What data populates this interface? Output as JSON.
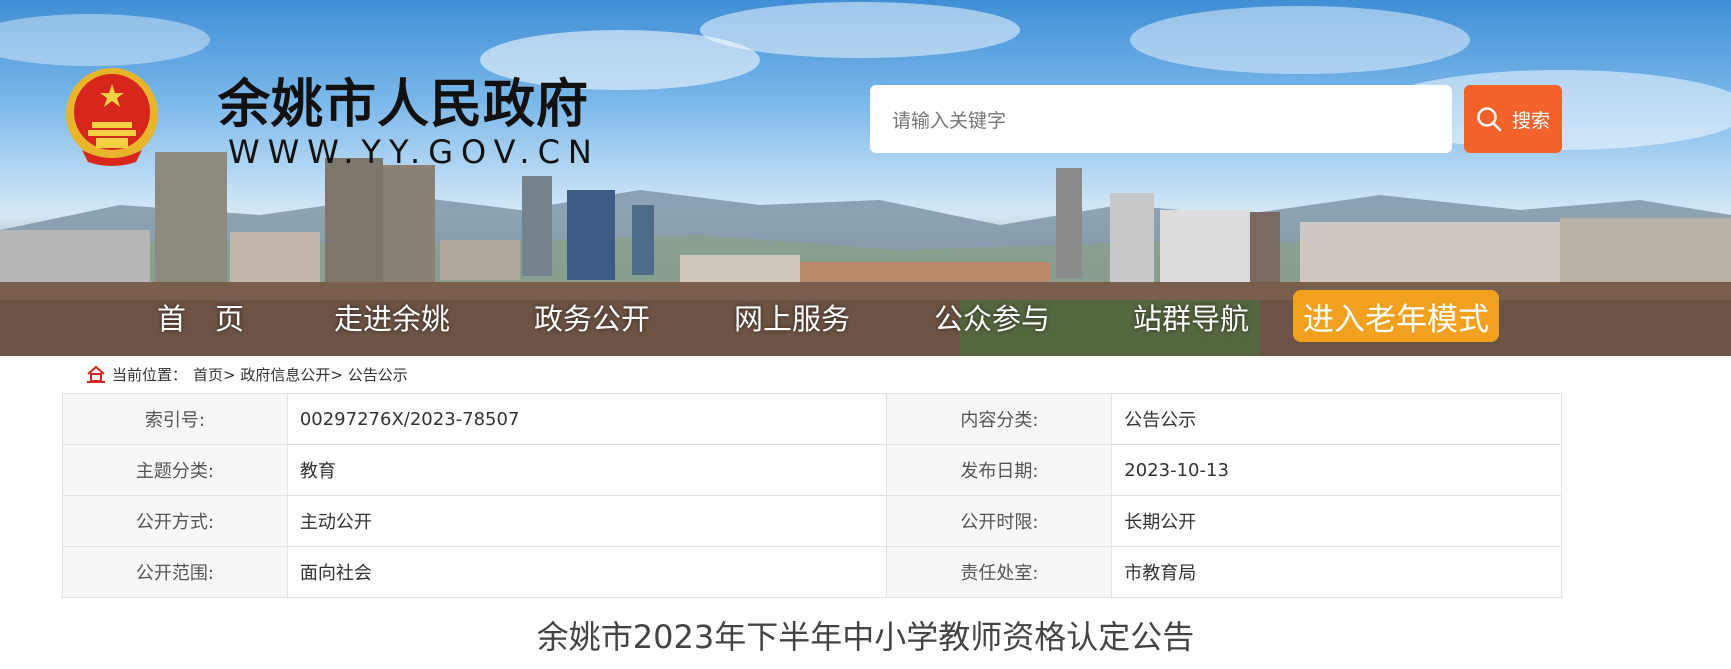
{
  "header": {
    "site_title": "余姚市人民政府",
    "site_url": "WWW.YY.GOV.CN",
    "emblem_icon": "national-emblem-icon"
  },
  "search": {
    "placeholder": "请输入关键字",
    "button_label": "搜索",
    "button_icon": "search-icon",
    "button_color": "#f2622a"
  },
  "nav": {
    "items": [
      "首　页",
      "走进余姚",
      "政务公开",
      "网上服务",
      "公众参与",
      "站群导航"
    ],
    "elder_mode_label": "进入老年模式",
    "elder_mode_color": "#f1a11d"
  },
  "breadcrumb": {
    "icon": "home-icon",
    "prefix": "当前位置：",
    "path": "首页> 政府信息公开> 公告公示"
  },
  "info": {
    "rows": [
      {
        "label1": "索引号:",
        "value1": "00297276X/2023-78507",
        "label2": "内容分类:",
        "value2": "公告公示"
      },
      {
        "label1": "主题分类:",
        "value1": "教育",
        "label2": "发布日期:",
        "value2": "2023-10-13"
      },
      {
        "label1": "公开方式:",
        "value1": "主动公开",
        "label2": "公开时限:",
        "value2": "长期公开"
      },
      {
        "label1": "公开范围:",
        "value1": "面向社会",
        "label2": "责任处室:",
        "value2": "市教育局"
      }
    ]
  },
  "article": {
    "title": "余姚市2023年下半年中小学教师资格认定公告"
  }
}
